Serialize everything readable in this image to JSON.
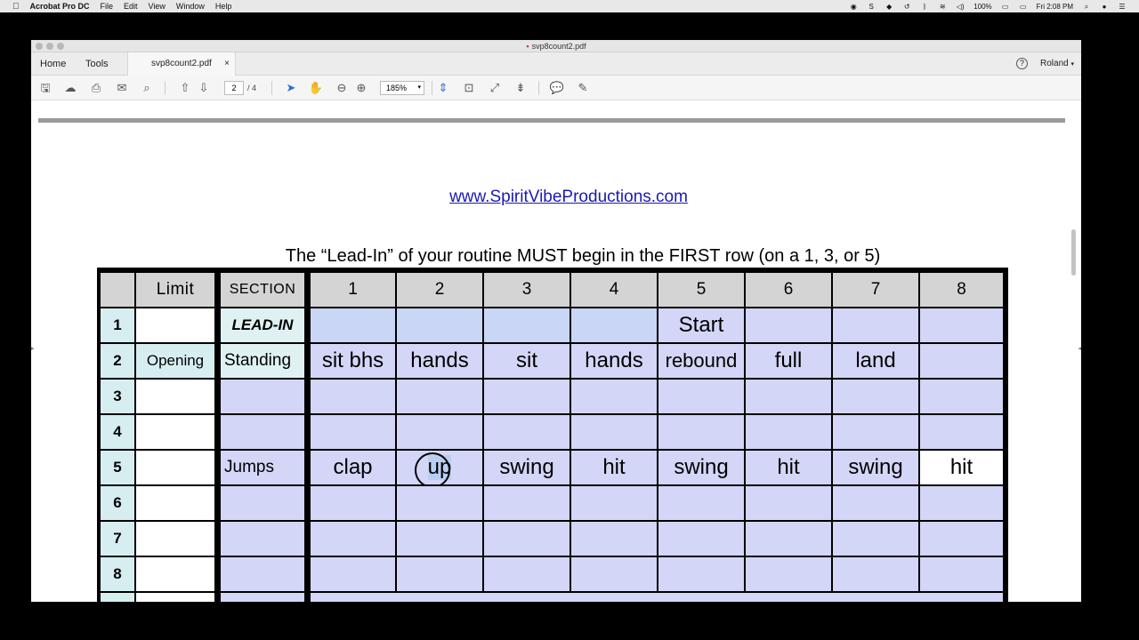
{
  "menubar": {
    "app_name": "Acrobat Pro DC",
    "items": [
      "File",
      "Edit",
      "View",
      "Window",
      "Help"
    ],
    "battery": "100%",
    "clock": "Fri 2:08 PM"
  },
  "window": {
    "title": "svp8count2.pdf"
  },
  "tabs": {
    "home": "Home",
    "tools": "Tools",
    "document": "svp8count2.pdf",
    "close": "×",
    "help": "?",
    "user": "Roland"
  },
  "toolbar": {
    "page_current": "2",
    "page_total": "/ 4",
    "zoom": "185%",
    "zoom_dropdown": "▾"
  },
  "document": {
    "link": "www.SpiritVibeProductions.com",
    "instruction": "The “Lead-In” of your routine MUST begin in the FIRST row (on a 1, 3, or 5)",
    "headers": {
      "limit": "Limit",
      "section": "SECTION",
      "beats": [
        "1",
        "2",
        "3",
        "4",
        "5",
        "6",
        "7",
        "8"
      ]
    },
    "rows": [
      {
        "num": "1",
        "limit": "",
        "section": "LEAD-IN",
        "cells": [
          "",
          "",
          "",
          "",
          "Start",
          "",
          "",
          ""
        ]
      },
      {
        "num": "2",
        "limit": "Opening",
        "section": "Standing",
        "cells": [
          "sit bhs",
          "hands",
          "sit",
          "hands",
          "rebound",
          "full",
          "land",
          ""
        ]
      },
      {
        "num": "3",
        "limit": "",
        "section": "",
        "cells": [
          "",
          "",
          "",
          "",
          "",
          "",
          "",
          ""
        ]
      },
      {
        "num": "4",
        "limit": "",
        "section": "",
        "cells": [
          "",
          "",
          "",
          "",
          "",
          "",
          "",
          ""
        ]
      },
      {
        "num": "5",
        "limit": "",
        "section": "Jumps",
        "cells": [
          "clap",
          "up",
          "swing",
          "hit",
          "swing",
          "hit",
          "swing",
          "hit"
        ]
      },
      {
        "num": "6",
        "limit": "",
        "section": "",
        "cells": [
          "",
          "",
          "",
          "",
          "",
          "",
          "",
          ""
        ]
      },
      {
        "num": "7",
        "limit": "",
        "section": "",
        "cells": [
          "",
          "",
          "",
          "",
          "",
          "",
          "",
          ""
        ]
      },
      {
        "num": "8",
        "limit": "",
        "section": "",
        "cells": [
          "",
          "",
          "",
          "",
          "",
          "",
          "",
          ""
        ]
      }
    ]
  }
}
